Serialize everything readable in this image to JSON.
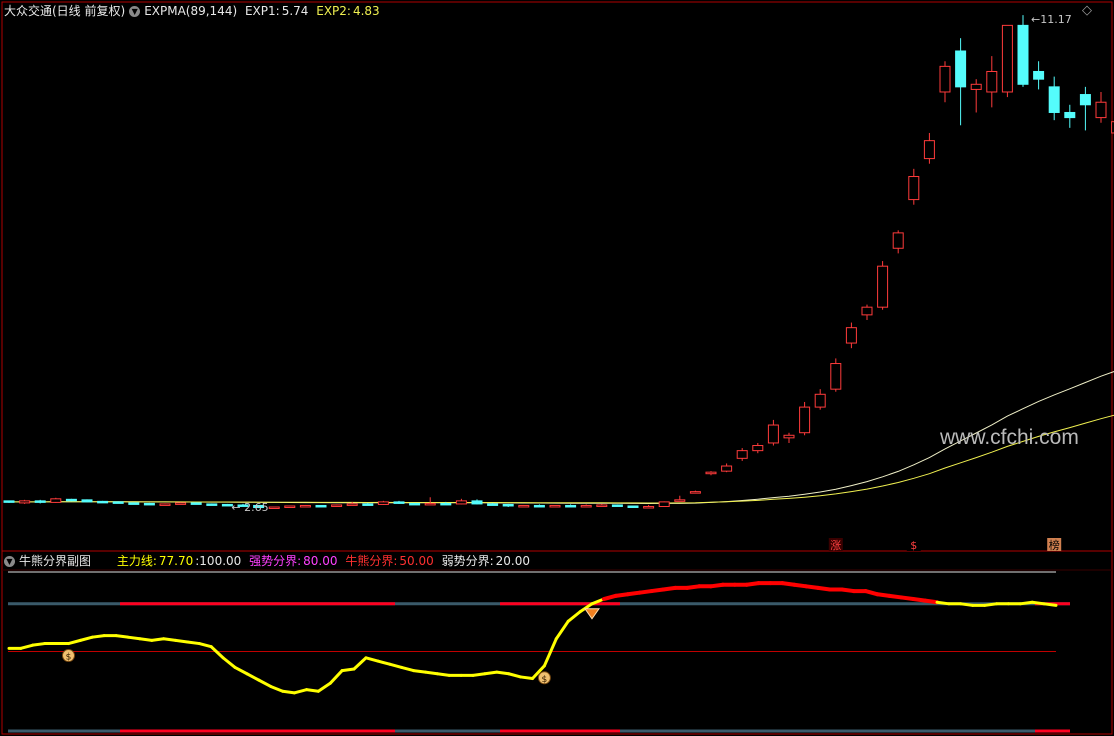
{
  "header": {
    "title": "大众交通(日线 前复权)",
    "indicator": "EXPMA(89,144)",
    "exp1_label": "EXP1:",
    "exp1_value": "5.74",
    "exp2_label": "EXP2:",
    "exp2_value": "4.83"
  },
  "sub_header": {
    "title": "牛熊分界副图",
    "main_label": "主力线:",
    "main_value": "77.70",
    "hundred": ":100.00",
    "strong_label": "强势分界:",
    "strong_value": "80.00",
    "bull_label": "牛熊分界:",
    "bull_value": "50.00",
    "weak_label": "弱势分界:",
    "weak_value": "20.00"
  },
  "watermark": "www.cfchi.com",
  "colors": {
    "up": "#ff3b3b",
    "down": "#54fcfc",
    "exp1": "#f0f0c8",
    "exp2": "#f0f050",
    "main_line": "#ffff00",
    "strong_line": "#ff0000",
    "frame": "#b00000",
    "white_ref": "#e0e0e0"
  },
  "chart_data": [
    {
      "type": "candlestick",
      "title": "大众交通(日线 前复权)",
      "ylim": [
        1.8,
        12.3
      ],
      "candles": [
        [
          2.72,
          2.72,
          2.68,
          2.7
        ],
        [
          2.68,
          2.74,
          2.66,
          2.72
        ],
        [
          2.72,
          2.74,
          2.67,
          2.69
        ],
        [
          2.69,
          2.78,
          2.68,
          2.76
        ],
        [
          2.75,
          2.76,
          2.71,
          2.73
        ],
        [
          2.74,
          2.75,
          2.69,
          2.7
        ],
        [
          2.71,
          2.72,
          2.68,
          2.7
        ],
        [
          2.7,
          2.71,
          2.67,
          2.68
        ],
        [
          2.68,
          2.69,
          2.65,
          2.67
        ],
        [
          2.67,
          2.68,
          2.64,
          2.65
        ],
        [
          2.65,
          2.67,
          2.64,
          2.66
        ],
        [
          2.66,
          2.69,
          2.65,
          2.68
        ],
        [
          2.68,
          2.69,
          2.65,
          2.66
        ],
        [
          2.66,
          2.67,
          2.63,
          2.65
        ],
        [
          2.65,
          2.66,
          2.62,
          2.64
        ],
        [
          2.64,
          2.66,
          2.62,
          2.63
        ],
        [
          2.63,
          2.64,
          2.58,
          2.59
        ],
        [
          2.59,
          2.61,
          2.57,
          2.6
        ],
        [
          2.6,
          2.63,
          2.59,
          2.62
        ],
        [
          2.62,
          2.64,
          2.6,
          2.63
        ],
        [
          2.63,
          2.64,
          2.61,
          2.62
        ],
        [
          2.62,
          2.65,
          2.61,
          2.64
        ],
        [
          2.64,
          2.7,
          2.63,
          2.66
        ],
        [
          2.66,
          2.68,
          2.64,
          2.65
        ],
        [
          2.65,
          2.72,
          2.64,
          2.7
        ],
        [
          2.7,
          2.72,
          2.66,
          2.67
        ],
        [
          2.67,
          2.68,
          2.64,
          2.65
        ],
        [
          2.65,
          2.79,
          2.64,
          2.67
        ],
        [
          2.67,
          2.7,
          2.64,
          2.66
        ],
        [
          2.66,
          2.76,
          2.65,
          2.72
        ],
        [
          2.72,
          2.75,
          2.65,
          2.66
        ],
        [
          2.66,
          2.68,
          2.63,
          2.65
        ],
        [
          2.65,
          2.66,
          2.6,
          2.62
        ],
        [
          2.62,
          2.64,
          2.6,
          2.63
        ],
        [
          2.63,
          2.65,
          2.61,
          2.62
        ],
        [
          2.62,
          2.64,
          2.6,
          2.63
        ],
        [
          2.63,
          2.65,
          2.61,
          2.62
        ],
        [
          2.62,
          2.65,
          2.6,
          2.63
        ],
        [
          2.63,
          2.66,
          2.61,
          2.64
        ],
        [
          2.64,
          2.65,
          2.61,
          2.62
        ],
        [
          2.62,
          2.63,
          2.58,
          2.6
        ],
        [
          2.6,
          2.64,
          2.59,
          2.61
        ],
        [
          2.61,
          2.71,
          2.6,
          2.7
        ],
        [
          2.74,
          2.82,
          2.72,
          2.74
        ],
        [
          2.9,
          2.92,
          2.88,
          2.9
        ],
        [
          3.25,
          3.3,
          3.22,
          3.28
        ],
        [
          3.3,
          3.45,
          3.28,
          3.4
        ],
        [
          3.55,
          3.75,
          3.5,
          3.7
        ],
        [
          3.7,
          3.85,
          3.65,
          3.8
        ],
        [
          3.85,
          4.3,
          3.8,
          4.2
        ],
        [
          3.95,
          4.05,
          3.85,
          4.0
        ],
        [
          4.05,
          4.65,
          4.0,
          4.55
        ],
        [
          4.55,
          4.9,
          4.5,
          4.8
        ],
        [
          4.9,
          5.5,
          4.85,
          5.4
        ],
        [
          5.8,
          6.2,
          5.7,
          6.1
        ],
        [
          6.35,
          6.55,
          6.25,
          6.5
        ],
        [
          6.5,
          7.4,
          6.45,
          7.3
        ],
        [
          7.65,
          8.0,
          7.55,
          7.95
        ],
        [
          8.6,
          9.2,
          8.5,
          9.05
        ],
        [
          9.4,
          9.9,
          9.3,
          9.75
        ],
        [
          10.7,
          11.3,
          10.5,
          11.2
        ],
        [
          11.5,
          11.75,
          10.05,
          10.8
        ],
        [
          10.75,
          10.95,
          10.3,
          10.85
        ],
        [
          10.7,
          11.4,
          10.4,
          11.1
        ],
        [
          10.7,
          12.0,
          10.6,
          12.0
        ],
        [
          12.0,
          12.2,
          10.8,
          10.85
        ],
        [
          11.1,
          11.3,
          10.75,
          10.95
        ],
        [
          10.8,
          11.0,
          10.15,
          10.3
        ],
        [
          10.3,
          10.45,
          10.0,
          10.2
        ],
        [
          10.65,
          10.8,
          9.95,
          10.45
        ],
        [
          10.2,
          10.7,
          10.1,
          10.5
        ],
        [
          9.9,
          10.35,
          9.7,
          10.12
        ],
        [
          10.05,
          10.35,
          9.75,
          10.25
        ],
        [
          10.15,
          10.35,
          9.6,
          10.05
        ],
        [
          9.85,
          10.2,
          9.6,
          9.7
        ],
        [
          10.05,
          10.5,
          9.9,
          10.1
        ],
        [
          10.1,
          10.35,
          9.95,
          10.2
        ],
        [
          10.0,
          10.8,
          9.9,
          10.6
        ],
        [
          10.2,
          11.0,
          10.0,
          10.8
        ],
        [
          10.8,
          11.25,
          10.7,
          10.85
        ],
        [
          10.85,
          10.95,
          10.0,
          10.0
        ]
      ],
      "markers": {
        "high_label": "11.17",
        "low_label": "2.65",
        "up_mark": "涨",
        "dollar_mark": "$",
        "list_mark": "榜"
      }
    },
    {
      "type": "line",
      "title": "牛熊分界副图",
      "ylim": [
        0,
        100
      ],
      "series": [
        {
          "name": "主力线",
          "values": [
            52,
            52,
            54,
            55,
            55,
            55,
            57,
            59,
            60,
            60,
            59,
            58,
            57,
            58,
            57,
            56,
            55,
            53,
            46,
            40,
            36,
            32,
            28,
            25,
            24,
            26,
            25,
            30,
            38,
            39,
            46,
            44,
            42,
            40,
            38,
            37,
            36,
            35,
            35,
            35,
            36,
            37,
            36,
            34,
            33,
            41,
            58,
            69,
            75,
            80,
            83,
            85,
            86,
            87,
            88,
            89,
            90,
            90,
            91,
            91,
            92,
            92,
            92,
            93,
            93,
            93,
            92,
            91,
            90,
            89,
            89,
            88,
            88,
            86,
            85,
            84,
            83,
            82,
            81,
            80,
            80,
            79,
            79,
            80,
            80,
            80,
            81,
            80,
            79
          ]
        },
        {
          "name": "强势分界",
          "values": [
            80
          ]
        },
        {
          "name": "牛熊分界",
          "values": [
            50
          ]
        },
        {
          "name": "弱势分界",
          "values": [
            20
          ]
        }
      ],
      "markers": {
        "gem_label": "◆",
        "dollar_label": "$"
      }
    }
  ]
}
